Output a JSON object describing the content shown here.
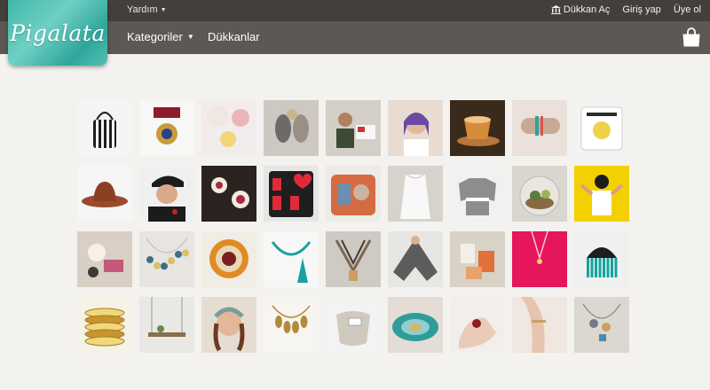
{
  "brand": {
    "logo_text": "Pigalata"
  },
  "topbar": {
    "help_label": "Yardım",
    "open_shop_label": "Dükkan Aç",
    "login_label": "Giriş yap",
    "signup_label": "Üye ol"
  },
  "nav": {
    "categories_label": "Kategoriler",
    "shops_label": "Dükkanlar"
  },
  "colors": {
    "topbar_bg": "#443f3b",
    "navbar_bg": "#5d5853",
    "page_bg": "#f3f2ef",
    "logo_teal": "#3fb7a8"
  },
  "products": [
    {
      "name": "striped-bucket-bag",
      "bg": "#f4f4f4",
      "fg": "#1e1e1e",
      "shape": "bag"
    },
    {
      "name": "medal-brooch",
      "bg": "#f7f7f5",
      "fg": "#8c1d2a",
      "shape": "medal"
    },
    {
      "name": "yarn-and-flowers",
      "bg": "#f2ecec",
      "fg": "#e9b6b9",
      "shape": "flowers"
    },
    {
      "name": "vintage-brooches",
      "bg": "#cdc8c1",
      "fg": "#6d6a6a",
      "shape": "brooch"
    },
    {
      "name": "women-reading",
      "bg": "#d3cfc6",
      "fg": "#3e4a34",
      "shape": "people"
    },
    {
      "name": "woman-portrait",
      "bg": "#e8dcd2",
      "fg": "#6a4aa3",
      "shape": "portrait"
    },
    {
      "name": "orange-ceramic-cup",
      "bg": "#3a2a1c",
      "fg": "#d68b38",
      "shape": "cup"
    },
    {
      "name": "bracelets-on-wrist",
      "bg": "#e9e1da",
      "fg": "#c9a993",
      "shape": "wrist"
    },
    {
      "name": "illustrated-pillow",
      "bg": "#f3f3f1",
      "fg": "#2b2b2b",
      "shape": "pillow"
    },
    {
      "name": "brown-felt-hat",
      "bg": "#f6f6f6",
      "fg": "#9a4b2a",
      "shape": "hat"
    },
    {
      "name": "man-in-cap",
      "bg": "#e9e9e9",
      "fg": "#1b1b1b",
      "shape": "man"
    },
    {
      "name": "mandala-earrings",
      "bg": "#2a2320",
      "fg": "#a52d3b",
      "shape": "earrings"
    },
    {
      "name": "love-pillow",
      "bg": "#e6e6e6",
      "fg": "#1f1f1f",
      "shape": "love"
    },
    {
      "name": "patchwork-cushions",
      "bg": "#ecebe6",
      "fg": "#d56b41",
      "shape": "cushion"
    },
    {
      "name": "white-top",
      "bg": "#e9e6e2",
      "fg": "#f8f8f8",
      "shape": "top"
    },
    {
      "name": "grey-sweater",
      "bg": "#f1f1f1",
      "fg": "#8d8d8d",
      "shape": "sweater"
    },
    {
      "name": "terrarium",
      "bg": "#d9d6d0",
      "fg": "#5e7b3f",
      "shape": "terrarium"
    },
    {
      "name": "yellow-wall-girl",
      "bg": "#f4d000",
      "fg": "#1c1c1c",
      "shape": "girl"
    },
    {
      "name": "pink-jewelry",
      "bg": "#d9cfc4",
      "fg": "#c2587a",
      "shape": "jewelry"
    },
    {
      "name": "bead-necklaces",
      "bg": "#e8e5e0",
      "fg": "#d8c063",
      "shape": "beads"
    },
    {
      "name": "retro-clock",
      "bg": "#f1ede4",
      "fg": "#e08b24",
      "shape": "clock"
    },
    {
      "name": "turquoise-tassel",
      "bg": "#f7f7f7",
      "fg": "#1aa0a0",
      "shape": "tassel"
    },
    {
      "name": "leather-necklace",
      "bg": "#cfcac3",
      "fg": "#7a6857",
      "shape": "leather"
    },
    {
      "name": "grey-poncho",
      "bg": "#e7e6e3",
      "fg": "#5c5c5c",
      "shape": "poncho"
    },
    {
      "name": "orange-tags",
      "bg": "#d9d2c6",
      "fg": "#e0713a",
      "shape": "tags"
    },
    {
      "name": "pink-backdrop-necklace",
      "bg": "#e6165c",
      "fg": "#f6c6d6",
      "shape": "pinkneck"
    },
    {
      "name": "teal-fringe-hat",
      "bg": "#f0f0f0",
      "fg": "#1e1e1e",
      "shape": "fringe"
    },
    {
      "name": "stacked-bracelets",
      "bg": "#f5f2e8",
      "fg": "#c7962c",
      "shape": "stack"
    },
    {
      "name": "hanging-shelf",
      "bg": "#e9e8e4",
      "fg": "#8a6d4e",
      "shape": "shelf"
    },
    {
      "name": "flower-crown-woman",
      "bg": "#e6ddd2",
      "fg": "#7a9e9a",
      "shape": "crown"
    },
    {
      "name": "gold-necklace",
      "bg": "#f6f5f2",
      "fg": "#b48a3a",
      "shape": "gold"
    },
    {
      "name": "canvas-pouch",
      "bg": "#f3f3f3",
      "fg": "#cfc9be",
      "shape": "pouch"
    },
    {
      "name": "ceramic-plates",
      "bg": "#e3ddd6",
      "fg": "#2f9c9a",
      "shape": "plates"
    },
    {
      "name": "red-ring-hand",
      "bg": "#f1eeec",
      "fg": "#8e1c24",
      "shape": "ring"
    },
    {
      "name": "arm-cuff",
      "bg": "#efe7e0",
      "fg": "#c99a86",
      "shape": "arm"
    },
    {
      "name": "charm-necklace",
      "bg": "#dcd7d0",
      "fg": "#6f7a86",
      "shape": "charms"
    }
  ]
}
